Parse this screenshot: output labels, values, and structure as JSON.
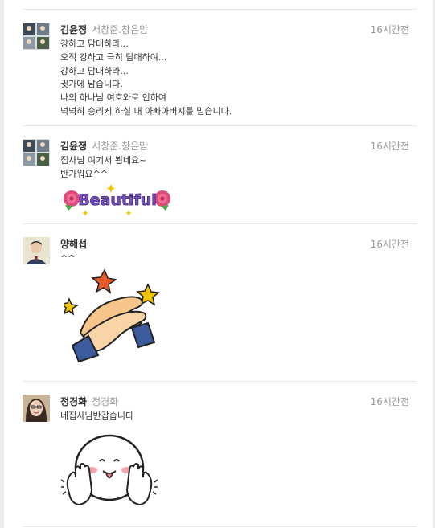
{
  "comments": [
    {
      "author": "김윤정",
      "alias": "서창준.창은맘",
      "time": "16시간전",
      "lines": [
        "강하고 담대하라...",
        "오직 강하고 극히 담대하여...",
        "강하고 담대하라...",
        "귓가에 남습니다.",
        "나의 하나님 여호와로 인하여",
        "넉넉히 승리케 하실 내 아빠아버지를 믿습니다."
      ]
    },
    {
      "author": "김윤정",
      "alias": "서창준.창은맘",
      "time": "16시간전",
      "lines": [
        "집사님 여기서 뵙네요~",
        "반가워요^^"
      ],
      "sticker_text": "Beautiful"
    },
    {
      "author": "양해섭",
      "alias": "",
      "time": "16시간전",
      "lines": [
        "^^"
      ],
      "sticker_icon": "clapping-hands-icon"
    },
    {
      "author": "정경화",
      "alias": "정경화",
      "time": "16시간전",
      "lines": [
        "네집사님반갑습니다"
      ],
      "sticker_icon": "waving-smiley-icon"
    }
  ],
  "colors": {
    "divider": "#e8e8e8",
    "author": "#333333",
    "muted": "#999999",
    "beautiful_text": "#7a4fc4",
    "rose": "#e04a7a",
    "sparkle": "#f2c200"
  }
}
